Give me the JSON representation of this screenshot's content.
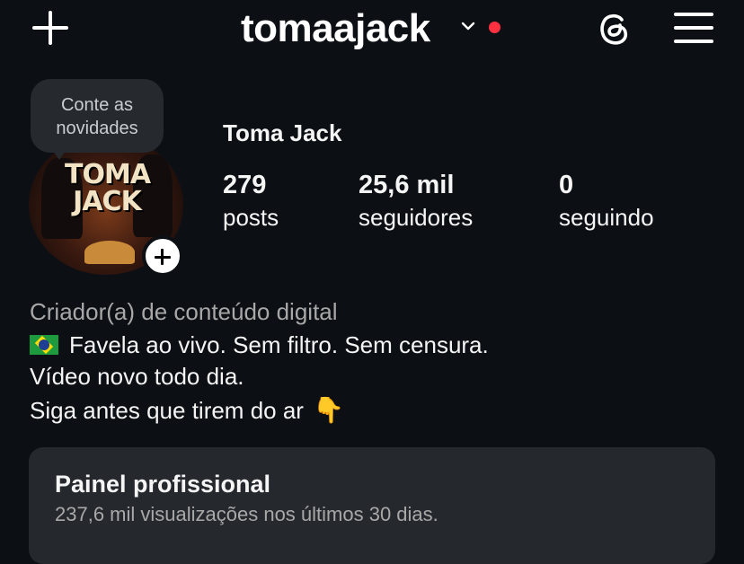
{
  "header": {
    "username": "tomaajack",
    "has_notification": true,
    "accent_dot_color": "#ff3040",
    "icons": [
      "plus-icon",
      "chevron-down-icon",
      "threads-icon",
      "menu-icon"
    ]
  },
  "avatar": {
    "bubble_line1": "Conte as",
    "bubble_line2": "novidades",
    "logo_line1": "TOMA",
    "logo_line2": "JACK"
  },
  "profile": {
    "full_name": "Toma Jack",
    "stats": [
      {
        "value": "279",
        "label": "posts"
      },
      {
        "value": "25,6 mil",
        "label": "seguidores"
      },
      {
        "value": "0",
        "label": "seguindo"
      }
    ],
    "category": "Criador(a) de conteúdo digital",
    "bio": [
      "Favela ao vivo. Sem filtro. Sem censura.",
      "Vídeo novo todo dia.",
      "Siga antes que tirem do ar"
    ],
    "bio_emoji": [
      "brazil-flag-emoji",
      "pointing-down-hand-emoji"
    ]
  },
  "pro_panel": {
    "title": "Painel profissional",
    "subtitle": "237,6 mil visualizações nos últimos 30 dias."
  }
}
